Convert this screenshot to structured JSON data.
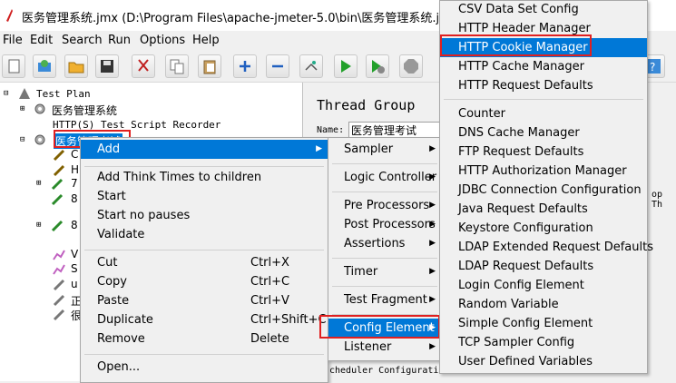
{
  "window": {
    "title": "医务管理系统.jmx (D:\\Program Files\\apache-jmeter-5.0\\bin\\医务管理系统.jmx) - A"
  },
  "menubar": [
    "File",
    "Edit",
    "Search",
    "Run",
    "Options",
    "Help"
  ],
  "toolbar": [
    "new-icon",
    "templates-icon",
    "open-icon",
    "save-icon",
    "cut-icon",
    "copy-icon",
    "paste-icon",
    "expand-icon",
    "collapse-icon",
    "toggle-icon",
    "start-icon",
    "start-no-pause-icon",
    "stop-icon"
  ],
  "tree": {
    "root": "Test Plan",
    "node1": "医务管理系统",
    "recorder": "HTTP(S) Test Script Recorder",
    "selected": "医务管理考试",
    "child_c": "C",
    "child_h": "H",
    "child_7": "7",
    "child_8a": "8",
    "child_8b": "8",
    "child_v": "V",
    "child_s": "S",
    "child_u": "u",
    "child_r1": "正",
    "child_r2": "很"
  },
  "panel": {
    "title": "Thread Group",
    "name_label": "Name:",
    "name_value": "医务管理考试",
    "loop_text": "op Th",
    "scheduler": "cheduler Configuration"
  },
  "context_menu": {
    "add": "Add",
    "think": "Add Think Times to children",
    "start": "Start",
    "start_no_pauses": "Start no pauses",
    "validate": "Validate",
    "cut": "Cut",
    "cut_sc": "Ctrl+X",
    "copy": "Copy",
    "copy_sc": "Ctrl+C",
    "paste": "Paste",
    "paste_sc": "Ctrl+V",
    "duplicate": "Duplicate",
    "duplicate_sc": "Ctrl+Shift+C",
    "remove": "Remove",
    "remove_sc": "Delete",
    "open": "Open..."
  },
  "add_menu": {
    "sampler": "Sampler",
    "logic": "Logic Controller",
    "pre": "Pre Processors",
    "post": "Post Processors",
    "assertions": "Assertions",
    "timer": "Timer",
    "fragment": "Test Fragment",
    "config": "Config Element",
    "listener": "Listener"
  },
  "config_menu": [
    "CSV Data Set Config",
    "HTTP Header Manager",
    "HTTP Cookie Manager",
    "HTTP Cache Manager",
    "HTTP Request Defaults",
    "Counter",
    "DNS Cache Manager",
    "FTP Request Defaults",
    "HTTP Authorization Manager",
    "JDBC Connection Configuration",
    "Java Request Defaults",
    "Keystore Configuration",
    "LDAP Extended Request Defaults",
    "LDAP Request Defaults",
    "Login Config Element",
    "Random Variable",
    "Simple Config Element",
    "TCP Sampler Config",
    "User Defined Variables"
  ],
  "colors": {
    "highlight": "#0078d7",
    "annotation": "#e02020"
  }
}
